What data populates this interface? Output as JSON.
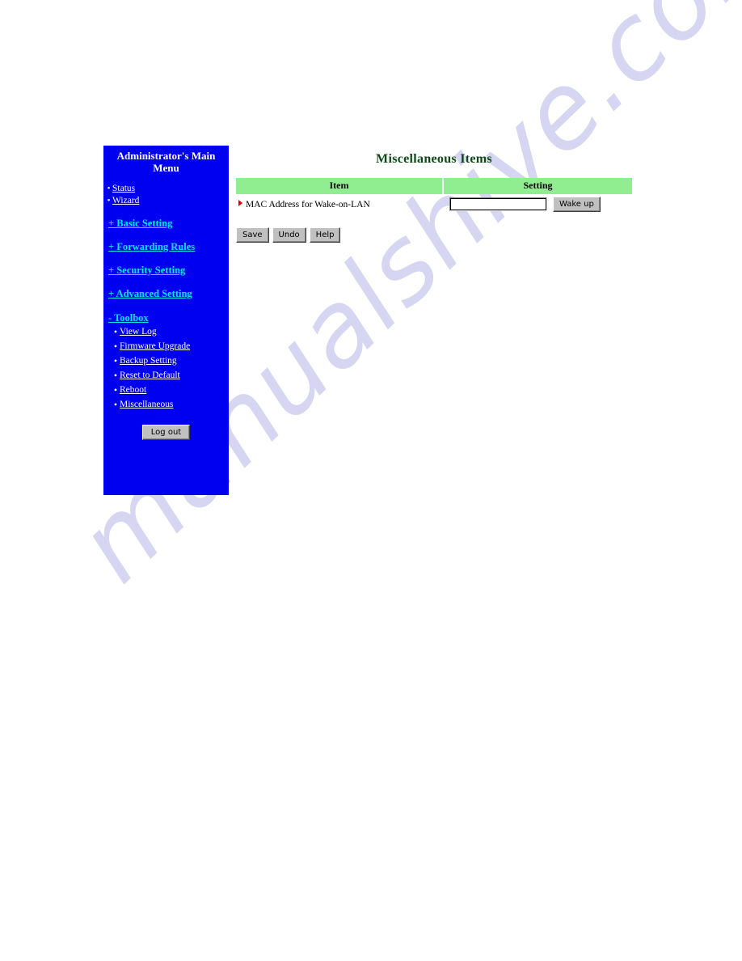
{
  "watermark": {
    "text": "manualshive.com"
  },
  "sidebar": {
    "title": "Administrator's Main Menu",
    "bg_color": "#0000f0",
    "top_links": [
      {
        "label": "Status",
        "bullet": "dot-bullet"
      },
      {
        "label": "Wizard",
        "bullet": "dot-bullet"
      }
    ],
    "sections": [
      {
        "label": "+ Basic Setting"
      },
      {
        "label": "+ Forwarding Rules"
      },
      {
        "label": "+ Security Setting"
      },
      {
        "label": "+ Advanced Setting"
      }
    ],
    "toolbox": {
      "label": "- Toolbox",
      "items": [
        {
          "label": "View Log"
        },
        {
          "label": "Firmware Upgrade"
        },
        {
          "label": "Backup Setting"
        },
        {
          "label": "Reset to Default"
        },
        {
          "label": "Reboot"
        },
        {
          "label": "Miscellaneous"
        }
      ]
    },
    "logout_label": "Log out"
  },
  "main": {
    "title": "Miscellaneous Items",
    "title_color": "#0b4a16",
    "header_color": "#90ee90",
    "columns": {
      "item": "Item",
      "setting": "Setting"
    },
    "rows": [
      {
        "item_label": "MAC Address for Wake-on-LAN",
        "bullet": "red-triangle-icon",
        "input_value": "",
        "input_placeholder": "",
        "action_label": "Wake up"
      }
    ],
    "buttons": {
      "save": "Save",
      "undo": "Undo",
      "help": "Help"
    }
  }
}
